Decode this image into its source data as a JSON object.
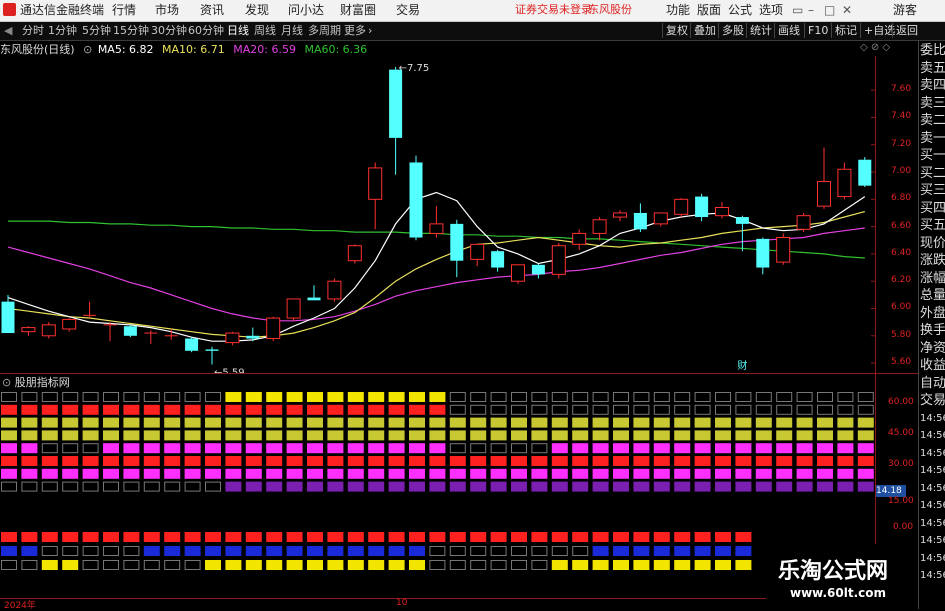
{
  "app": {
    "title": "通达信金融终端",
    "menus": [
      "行情",
      "市场",
      "资讯",
      "发现",
      "问小达",
      "财富圈",
      "交易"
    ],
    "notice": "证券交易未登录",
    "stock_name_header": "东风股份",
    "right_menus": [
      "功能",
      "版面",
      "公式",
      "选项"
    ],
    "user": "游客"
  },
  "tabs": {
    "periods": [
      "分时",
      "1分钟",
      "5分钟",
      "15分钟",
      "30分钟",
      "60分钟",
      "日线",
      "周线",
      "月线",
      "多周期",
      "更多"
    ],
    "active": "日线",
    "right_buttons": [
      "复权",
      "叠加",
      "多股",
      "统计",
      "画线",
      "F10",
      "标记",
      "+自选",
      "返回"
    ]
  },
  "legend": {
    "name": "东风股份(日线)",
    "ma5": "MA5: 6.82",
    "ma10": "MA10: 6.71",
    "ma20": "MA20: 6.59",
    "ma60": "MA60: 6.36"
  },
  "colors": {
    "up": "#ff3030",
    "down": "#54ffff",
    "ma5": "#ffffff",
    "ma10": "#e8e05a",
    "ma20": "#e040e0",
    "ma60": "#30c030",
    "axis": "#8b1a1a",
    "tick": "#dd2222"
  },
  "price_axis": {
    "ticks": [
      "7.60",
      "7.40",
      "7.20",
      "7.00",
      "6.80",
      "6.60",
      "6.40",
      "6.20",
      "6.00",
      "5.80",
      "5.60"
    ],
    "min": 5.52,
    "max": 7.85
  },
  "annotations": {
    "high": "7.75",
    "low": "5.59",
    "fin_marker": "财"
  },
  "indicator": {
    "title": "股朋指标网",
    "ticks": [
      "60.00",
      "45.00",
      "30.00",
      "15.00",
      "0.00"
    ],
    "value_badge": "14.18"
  },
  "right_panel": {
    "labels": [
      "委比",
      "卖五",
      "卖四",
      "卖三",
      "卖二",
      "卖一",
      "买一",
      "买二",
      "买三",
      "买四",
      "买五",
      "现价",
      "涨跌",
      "涨幅",
      "总量",
      "外盘",
      "换手",
      "净资",
      "收益",
      "自动",
      "交易",
      "14:56",
      "14:56",
      "14:56",
      "14:56",
      "14:56",
      "14:56",
      "14:56",
      "14:56",
      "14:56",
      "14:56"
    ]
  },
  "time_axis": {
    "labels": [
      "2024年",
      "10"
    ]
  },
  "watermark": {
    "title": "乐淘公式网",
    "url": "www.60lt.com"
  },
  "chart_data": {
    "type": "candlestick",
    "candles": [
      {
        "o": 6.05,
        "h": 6.1,
        "l": 5.82,
        "c": 5.82
      },
      {
        "o": 5.83,
        "h": 5.87,
        "l": 5.8,
        "c": 5.86
      },
      {
        "o": 5.8,
        "h": 5.9,
        "l": 5.78,
        "c": 5.88
      },
      {
        "o": 5.85,
        "h": 5.93,
        "l": 5.83,
        "c": 5.92
      },
      {
        "o": 5.95,
        "h": 6.05,
        "l": 5.93,
        "c": 5.95
      },
      {
        "o": 5.88,
        "h": 5.9,
        "l": 5.76,
        "c": 5.88
      },
      {
        "o": 5.87,
        "h": 5.88,
        "l": 5.79,
        "c": 5.8
      },
      {
        "o": 5.82,
        "h": 5.84,
        "l": 5.74,
        "c": 5.82
      },
      {
        "o": 5.8,
        "h": 5.85,
        "l": 5.77,
        "c": 5.8
      },
      {
        "o": 5.78,
        "h": 5.79,
        "l": 5.68,
        "c": 5.69
      },
      {
        "o": 5.7,
        "h": 5.72,
        "l": 5.59,
        "c": 5.69
      },
      {
        "o": 5.75,
        "h": 5.83,
        "l": 5.73,
        "c": 5.82
      },
      {
        "o": 5.8,
        "h": 5.86,
        "l": 5.76,
        "c": 5.78
      },
      {
        "o": 5.78,
        "h": 5.94,
        "l": 5.76,
        "c": 5.93
      },
      {
        "o": 5.93,
        "h": 6.07,
        "l": 5.91,
        "c": 6.07
      },
      {
        "o": 6.08,
        "h": 6.17,
        "l": 6.06,
        "c": 6.06
      },
      {
        "o": 6.07,
        "h": 6.22,
        "l": 6.05,
        "c": 6.2
      },
      {
        "o": 6.35,
        "h": 6.47,
        "l": 6.33,
        "c": 6.46
      },
      {
        "o": 6.8,
        "h": 7.07,
        "l": 6.58,
        "c": 7.03
      },
      {
        "o": 7.75,
        "h": 7.77,
        "l": 6.98,
        "c": 7.25
      },
      {
        "o": 7.07,
        "h": 7.12,
        "l": 6.5,
        "c": 6.52
      },
      {
        "o": 6.55,
        "h": 6.75,
        "l": 6.52,
        "c": 6.62
      },
      {
        "o": 6.62,
        "h": 6.65,
        "l": 6.23,
        "c": 6.35
      },
      {
        "o": 6.36,
        "h": 6.47,
        "l": 6.31,
        "c": 6.47
      },
      {
        "o": 6.42,
        "h": 6.43,
        "l": 6.27,
        "c": 6.3
      },
      {
        "o": 6.2,
        "h": 6.32,
        "l": 6.18,
        "c": 6.32
      },
      {
        "o": 6.32,
        "h": 6.33,
        "l": 6.22,
        "c": 6.25
      },
      {
        "o": 6.25,
        "h": 6.48,
        "l": 6.22,
        "c": 6.46
      },
      {
        "o": 6.47,
        "h": 6.58,
        "l": 6.43,
        "c": 6.55
      },
      {
        "o": 6.55,
        "h": 6.67,
        "l": 6.5,
        "c": 6.65
      },
      {
        "o": 6.67,
        "h": 6.72,
        "l": 6.64,
        "c": 6.7
      },
      {
        "o": 6.7,
        "h": 6.77,
        "l": 6.56,
        "c": 6.58
      },
      {
        "o": 6.62,
        "h": 6.7,
        "l": 6.6,
        "c": 6.7
      },
      {
        "o": 6.69,
        "h": 6.81,
        "l": 6.67,
        "c": 6.8
      },
      {
        "o": 6.82,
        "h": 6.84,
        "l": 6.64,
        "c": 6.67
      },
      {
        "o": 6.68,
        "h": 6.78,
        "l": 6.66,
        "c": 6.74
      },
      {
        "o": 6.67,
        "h": 6.68,
        "l": 6.42,
        "c": 6.62
      },
      {
        "o": 6.51,
        "h": 6.52,
        "l": 6.25,
        "c": 6.3
      },
      {
        "o": 6.34,
        "h": 6.55,
        "l": 6.32,
        "c": 6.52
      },
      {
        "o": 6.58,
        "h": 6.7,
        "l": 6.56,
        "c": 6.68
      },
      {
        "o": 6.75,
        "h": 7.18,
        "l": 6.73,
        "c": 6.93
      },
      {
        "o": 6.82,
        "h": 7.07,
        "l": 6.8,
        "c": 7.02
      },
      {
        "o": 7.09,
        "h": 7.11,
        "l": 6.89,
        "c": 6.9
      }
    ],
    "ma60": [
      6.64,
      6.64,
      6.64,
      6.63,
      6.63,
      6.62,
      6.62,
      6.61,
      6.61,
      6.6,
      6.6,
      6.59,
      6.59,
      6.58,
      6.58,
      6.57,
      6.57,
      6.56,
      6.56,
      6.56,
      6.55,
      6.55,
      6.54,
      6.54,
      6.53,
      6.53,
      6.52,
      6.52,
      6.51,
      6.51,
      6.5,
      6.49,
      6.48,
      6.47,
      6.46,
      6.45,
      6.44,
      6.43,
      6.42,
      6.41,
      6.4,
      6.38,
      6.37
    ],
    "ma20": [
      6.45,
      6.41,
      6.37,
      6.33,
      6.29,
      6.24,
      6.19,
      6.15,
      6.1,
      6.05,
      6.0,
      5.96,
      5.93,
      5.91,
      5.91,
      5.92,
      5.94,
      5.98,
      6.03,
      6.09,
      6.13,
      6.16,
      6.19,
      6.21,
      6.23,
      6.24,
      6.25,
      6.27,
      6.28,
      6.3,
      6.33,
      6.36,
      6.39,
      6.41,
      6.44,
      6.47,
      6.49,
      6.5,
      6.51,
      6.52,
      6.55,
      6.57,
      6.59
    ],
    "ma10": [
      6.0,
      5.98,
      5.96,
      5.94,
      5.93,
      5.91,
      5.89,
      5.87,
      5.85,
      5.83,
      5.81,
      5.8,
      5.79,
      5.8,
      5.82,
      5.86,
      5.91,
      5.97,
      6.08,
      6.2,
      6.29,
      6.36,
      6.42,
      6.47,
      6.48,
      6.5,
      6.52,
      6.5,
      6.48,
      6.46,
      6.45,
      6.47,
      6.48,
      6.5,
      6.52,
      6.55,
      6.57,
      6.59,
      6.6,
      6.61,
      6.63,
      6.67,
      6.71
    ],
    "ma5": [
      6.08,
      6.03,
      5.98,
      5.94,
      5.9,
      5.89,
      5.88,
      5.86,
      5.83,
      5.79,
      5.76,
      5.76,
      5.77,
      5.8,
      5.87,
      5.93,
      6.0,
      6.15,
      6.35,
      6.62,
      6.8,
      6.85,
      6.79,
      6.6,
      6.45,
      6.4,
      6.33,
      6.36,
      6.4,
      6.46,
      6.55,
      6.59,
      6.64,
      6.67,
      6.69,
      6.7,
      6.65,
      6.59,
      6.57,
      6.58,
      6.62,
      6.72,
      6.82
    ],
    "indicator_rows": [
      {
        "color": "#f2e600",
        "pattern": "0000000000011111111111000000000000000000000000000000000000000000000000111111111111000011111"
      },
      {
        "color": "#ff2020",
        "pattern": "1111111111111111111111000000000000000000000000000000000000000000000000000000000000000011111"
      },
      {
        "color": "#c8c832",
        "pattern": "1111111111111111111111111111111111111111111111111111111111111111111111111111111111111111111"
      },
      {
        "color": "#c8c832",
        "pattern": "1111111111111111111111111111111111111111111111111111111111111111111111111111111111111111111"
      },
      {
        "color": "#ff30ff",
        "pattern": "1100011111111111111111000001111111111111111000000000000000000111111111111111111111111111111"
      },
      {
        "color": "#ff2020",
        "pattern": "1111111111111111111111111111111111111111111111111111111111111111111111111111111111111111111"
      },
      {
        "color": "#ff30ff",
        "pattern": "1111111111111111111111111111111111111111111111111111111111111111111111111111111111111111111"
      },
      {
        "color": "#7a1fb0",
        "pattern": "0000000000011111111111111111111111111111111111000000000000111111111111111111111111111111111"
      }
    ],
    "lower_rows": [
      {
        "color": "#ff2020",
        "pattern": "1111111111111111111111111111111111111"
      },
      {
        "color": "#1a2ad8",
        "pattern": "1100000111111111111110000000011111111"
      },
      {
        "color": "#f2e600",
        "pattern": "0011000000111111111110000001111111111"
      }
    ]
  }
}
